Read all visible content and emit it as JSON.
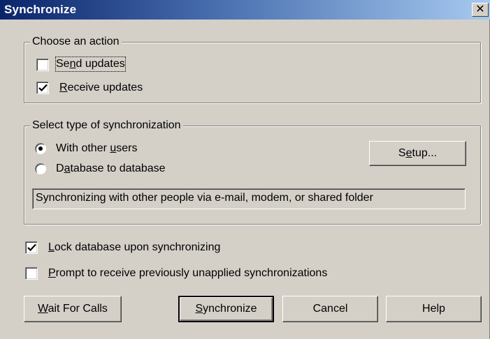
{
  "window": {
    "title": "Synchronize",
    "close_glyph": "✕"
  },
  "action_group": {
    "label": "Choose an action",
    "send_updates": {
      "pre": "Se",
      "u": "n",
      "post": "d updates",
      "checked": false
    },
    "receive_updates": {
      "pre": "",
      "u": "R",
      "post": "eceive updates",
      "checked": true
    }
  },
  "sync_type_group": {
    "label": "Select type of synchronization",
    "with_other_users": {
      "pre": "With other ",
      "u": "u",
      "post": "sers",
      "selected": true
    },
    "database_to_database": {
      "pre": "D",
      "u": "a",
      "post": "tabase to database",
      "selected": false
    },
    "setup_button": {
      "pre": "S",
      "u": "e",
      "post": "tup..."
    },
    "description": "Synchronizing with other people via e-mail, modem, or shared folder"
  },
  "options": {
    "lock_database": {
      "pre": "",
      "u": "L",
      "post": "ock database upon synchronizing",
      "checked": true
    },
    "prompt_receive": {
      "pre": "",
      "u": "P",
      "post": "rompt to receive previously unapplied synchronizations",
      "checked": false
    }
  },
  "buttons": {
    "wait_for_calls": {
      "pre": "",
      "u": "W",
      "post": "ait For Calls"
    },
    "synchronize": {
      "pre": "",
      "u": "S",
      "post": "ynchronize"
    },
    "cancel": "Cancel",
    "help": "Help"
  },
  "icons": {
    "checkbox": "checkmark-icon",
    "radio": "radio-dot-icon",
    "close": "close-icon"
  },
  "colors": {
    "title_start": "#0a246a",
    "title_end": "#a6caf0",
    "face": "#d4d0c8"
  }
}
